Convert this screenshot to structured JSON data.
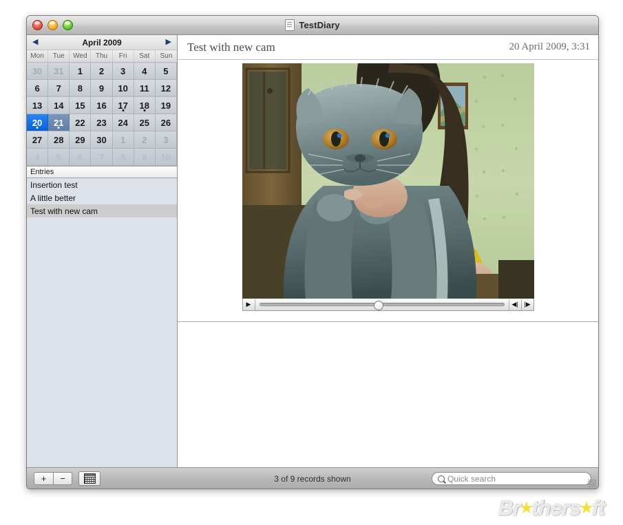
{
  "window": {
    "title": "TestDiary",
    "doc_icon": "document-icon",
    "traffic_lights": [
      "close",
      "minimize",
      "zoom"
    ]
  },
  "calendar": {
    "prev_icon": "◀",
    "next_icon": "▶",
    "month_label": "April 2009",
    "weekdays": [
      "Mon",
      "Tue",
      "Wed",
      "Thu",
      "Fri",
      "Sat",
      "Sun"
    ],
    "weeks": [
      [
        {
          "n": "30",
          "state": "out"
        },
        {
          "n": "31",
          "state": "out"
        },
        {
          "n": "1",
          "state": "in"
        },
        {
          "n": "2",
          "state": "in"
        },
        {
          "n": "3",
          "state": "in"
        },
        {
          "n": "4",
          "state": "in"
        },
        {
          "n": "5",
          "state": "in"
        }
      ],
      [
        {
          "n": "6",
          "state": "in"
        },
        {
          "n": "7",
          "state": "in"
        },
        {
          "n": "8",
          "state": "in"
        },
        {
          "n": "9",
          "state": "in"
        },
        {
          "n": "10",
          "state": "in"
        },
        {
          "n": "11",
          "state": "in"
        },
        {
          "n": "12",
          "state": "in"
        }
      ],
      [
        {
          "n": "13",
          "state": "in"
        },
        {
          "n": "14",
          "state": "in"
        },
        {
          "n": "15",
          "state": "in"
        },
        {
          "n": "16",
          "state": "in"
        },
        {
          "n": "17",
          "state": "in",
          "dot": true
        },
        {
          "n": "18",
          "state": "in",
          "dot": true
        },
        {
          "n": "19",
          "state": "in"
        }
      ],
      [
        {
          "n": "20",
          "state": "sel",
          "dot": true
        },
        {
          "n": "21",
          "state": "sel2",
          "dot": true
        },
        {
          "n": "22",
          "state": "in"
        },
        {
          "n": "23",
          "state": "in"
        },
        {
          "n": "24",
          "state": "in"
        },
        {
          "n": "25",
          "state": "in"
        },
        {
          "n": "26",
          "state": "in"
        }
      ],
      [
        {
          "n": "27",
          "state": "in"
        },
        {
          "n": "28",
          "state": "in"
        },
        {
          "n": "29",
          "state": "in"
        },
        {
          "n": "30",
          "state": "in"
        },
        {
          "n": "1",
          "state": "out"
        },
        {
          "n": "2",
          "state": "out"
        },
        {
          "n": "3",
          "state": "out"
        }
      ],
      [
        {
          "n": "4",
          "state": "dim"
        },
        {
          "n": "5",
          "state": "dim"
        },
        {
          "n": "6",
          "state": "dim"
        },
        {
          "n": "7",
          "state": "dim"
        },
        {
          "n": "8",
          "state": "dim"
        },
        {
          "n": "9",
          "state": "dim"
        },
        {
          "n": "10",
          "state": "dim"
        }
      ]
    ]
  },
  "entries": {
    "header": "Entries",
    "items": [
      {
        "title": "Insertion test",
        "selected": false
      },
      {
        "title": "A little better",
        "selected": false
      },
      {
        "title": "Test with new cam",
        "selected": true
      }
    ]
  },
  "entry_view": {
    "title": "Test with new cam",
    "date": "20 April 2009, 3:31",
    "media": {
      "type": "video",
      "description": "Webcam photo of a grey British Shorthair cat held by a person in a yellow shirt",
      "play_icon": "▶",
      "step_back_icon": "◀|",
      "step_forward_icon": "|▶",
      "scrub_position_percent": 47
    },
    "note_text": ""
  },
  "bottom_bar": {
    "add_label": "+",
    "remove_label": "−",
    "grid_icon": "calendar-grid-icon",
    "records_status": "3 of 9 records shown",
    "search_placeholder": "Quick search",
    "search_icon": "search-icon"
  },
  "watermark": {
    "part1": "Br",
    "star1": "★",
    "part2": "thers",
    "star2": "★",
    "part3": "ft"
  }
}
